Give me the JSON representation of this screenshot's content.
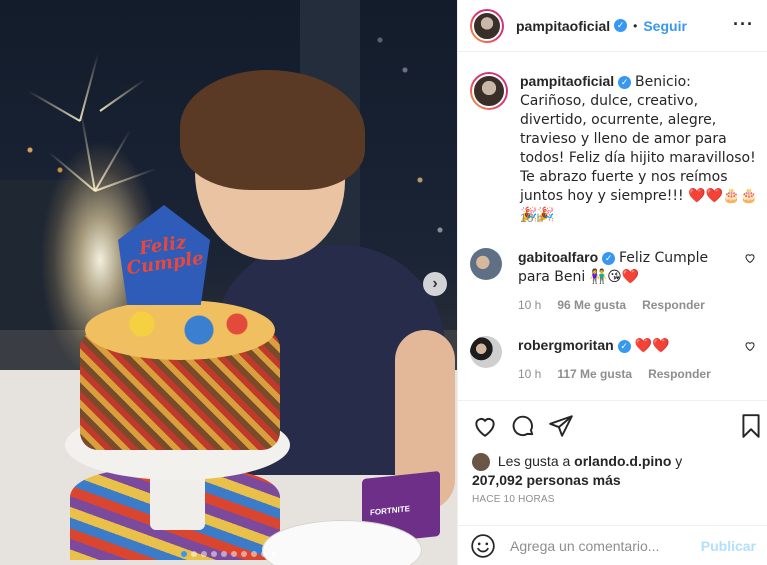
{
  "post": {
    "photo_sign_text": "Feliz Cumple",
    "toy_box_text": "FORTNITE",
    "carousel_next_glyph": "›",
    "carousel_dots": 10,
    "carousel_active_dot": 0
  },
  "header": {
    "username": "pampitaoficial",
    "verified_glyph": "✓",
    "separator": "•",
    "follow_label": "Seguir",
    "more_glyph": "···"
  },
  "caption": {
    "username": "pampitaoficial",
    "verified_glyph": "✓",
    "text": "Benicio: Cariñoso, dulce, creativo, divertido, ocurrente, alegre, travieso y lleno de amor para todos! Feliz día hijito maravilloso! Te abrazo fuerte y nos reímos juntos hoy y siempre!!! ❤️❤️🎂🎂🎉🎉",
    "time": "10 h"
  },
  "comments": [
    {
      "username": "gabitoalfaro",
      "verified": true,
      "text": "Feliz Cumple para Beni 👫😘❤️",
      "time": "10 h",
      "likes": "96 Me gusta",
      "reply": "Responder"
    },
    {
      "username": "robergmoritan",
      "verified": true,
      "text": "❤️❤️",
      "time": "10 h",
      "likes": "117 Me gusta",
      "reply": "Responder"
    }
  ],
  "likes": {
    "prefix": "Les gusta a",
    "user": "orlando.d.pino",
    "connector": "y",
    "count": "207,092 personas más"
  },
  "time_ago": "HACE 10 HORAS",
  "comment_box": {
    "placeholder": "Agrega un comentario...",
    "publish_label": "Publicar"
  },
  "icons": {
    "like": "heart-icon",
    "comment": "comment-icon",
    "share": "share-icon",
    "save": "bookmark-icon",
    "emoji": "emoji-icon"
  },
  "colors": {
    "accent": "#3897f0",
    "publish_disabled": "#b2dffc",
    "muted": "#8e8e8e",
    "text": "#262626"
  }
}
